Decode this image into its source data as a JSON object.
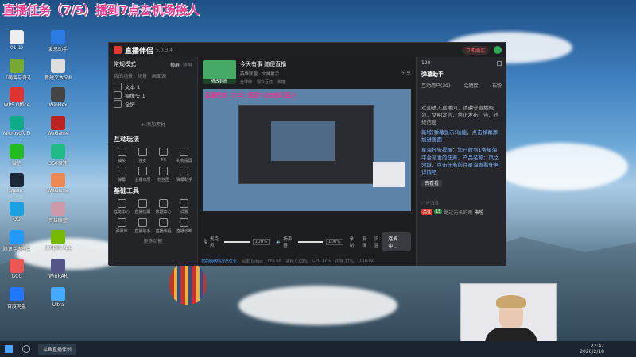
{
  "overlay_title": "直播任务（7/5）播到7点去机场接人",
  "desktop_icons": [
    {
      "label": "01(1)",
      "color": "#eeeeee"
    },
    {
      "label": "爱思助手",
      "color": "#2c7be5"
    },
    {
      "label": "《萌兽与奇迹》",
      "color": "#7a3"
    },
    {
      "label": "新建文本文档",
      "color": "#ddd"
    },
    {
      "label": "WPS Office",
      "color": "#d33"
    },
    {
      "label": "WinHex",
      "color": "#444"
    },
    {
      "label": "Microsoft Edge",
      "color": "#1a8"
    },
    {
      "label": "WeGame",
      "color": "#b22"
    },
    {
      "label": "微信",
      "color": "#2b2"
    },
    {
      "label": "360极速",
      "color": "#2b8"
    },
    {
      "label": "Steam",
      "color": "#1b2838"
    },
    {
      "label": "WeGame",
      "color": "#e85"
    },
    {
      "label": "QQ",
      "color": "#1ba1e2"
    },
    {
      "label": "英雄联盟",
      "color": "#c9a"
    },
    {
      "label": "腾讯手游助手",
      "color": "#29f"
    },
    {
      "label": "NVIDIA App",
      "color": "#76b900"
    },
    {
      "label": "GCC",
      "color": "#e55"
    },
    {
      "label": "WinRAR",
      "color": "#558"
    },
    {
      "label": "百度网盘",
      "color": "#27f"
    },
    {
      "label": "Ultra",
      "color": "#4af"
    }
  ],
  "app": {
    "logo": "直播伴侣",
    "version": "5.0.3.4",
    "close_hint": "立即购买",
    "mode_label": "常规模式",
    "mode_tabs": [
      "横屏",
      "竖屏"
    ],
    "scene_label": "我的场景",
    "scene_tabs": [
      "场景",
      "画面源"
    ],
    "sources": [
      "文本 1",
      "摄像头 1",
      "全屏"
    ],
    "add_source": "+ 添加素材",
    "interact_title": "互动玩法",
    "interact_items": [
      "抽奖",
      "连麦",
      "PK",
      "礼物投屏",
      "弹幕",
      "主播日历",
      "粉丝团",
      "弹幕助手"
    ],
    "tools_title": "基础工具",
    "tools_items": [
      "任务中心",
      "直播快照",
      "数据中心",
      "设置",
      "弹幕库",
      "直播助手",
      "直播伴侣",
      "直播诊断"
    ],
    "more_label": "更多功能",
    "live_title": "今天有事 随便直播",
    "live_category": "英雄联盟 · 大神射手",
    "live_tags": [
      "全球榜",
      "观众互动",
      "热度"
    ],
    "share_label": "分享",
    "cover_label": "修改封面",
    "preview_overlay": "直播任务（7/5）播到7点去机场接人",
    "mic_label": "麦克风",
    "mic_value": "100%",
    "speaker_label": "扬声器",
    "speaker_value": "100%",
    "record_label": "录制",
    "clip_label": "剪辑",
    "settings_label": "设置",
    "start_btn": "连麦中...",
    "status_bar": [
      "码率 0kbps",
      "FPS 60",
      "丢帧 0.00%",
      "CPU 17%",
      "内存 17%",
      "0:18:02"
    ],
    "status_warning": "您的网络情况已优化",
    "right_tabs": [
      "弹幕助手"
    ],
    "right_subtabs": [
      "互动用户(39)",
      "话题接",
      "石粉"
    ],
    "right_header_count": "120",
    "chat_messages": [
      {
        "text": "欢迎进入直播间，请遵守直播规范，文明发言，禁止发布广告、违规信息",
        "blue": false
      },
      {
        "text": "新增(弹幕显示)功能，点击弹幕添加进画面",
        "blue": true
      },
      {
        "text": "星海任务提醒：您已收到1条星海平台派发的任务，产品名称：风之领域，点击任务前往星海查看任务详情吧",
        "blue": true
      }
    ],
    "view_btn": "去看看",
    "gift_label": "广告消息",
    "user_badge": "关注",
    "user_name": "路过无名的雨",
    "user_msg": "来啦",
    "user_level": "15"
  },
  "taskbar": {
    "app_label": "斗鱼直播伴侣",
    "time": "22:42",
    "date": "2026/2/18"
  },
  "colors": {
    "accent_red": "#e53935",
    "accent_blue": "#4aa3ff",
    "panel_bg": "#25262b"
  }
}
